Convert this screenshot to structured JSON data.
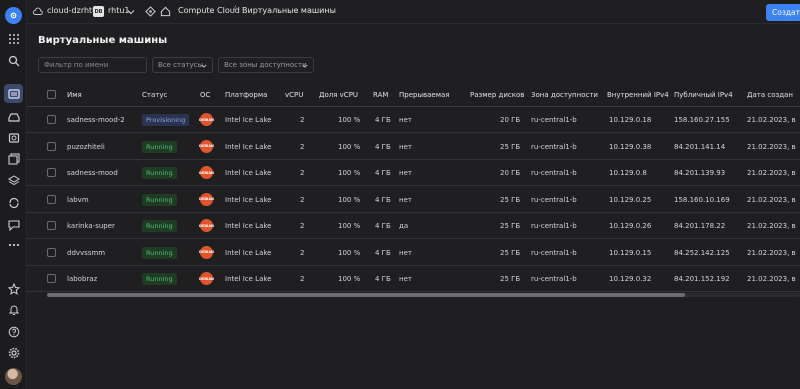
{
  "topbar": {
    "cloud": "cloud-dzrhtu",
    "folder_badge": "DB",
    "folder": "rhtu1",
    "service": "Compute Cloud",
    "separator": "/",
    "page": "Виртуальные машины",
    "create_label": "Создать"
  },
  "page": {
    "title": "Виртуальные машины",
    "search_placeholder": "Фильтр по имени",
    "status_filter": "Все статусы",
    "zone_filter": "Все зоны доступности"
  },
  "table": {
    "headers": [
      "Имя",
      "Статус",
      "ОС",
      "Платформа",
      "vCPU",
      "Доля vCPU",
      "RAM",
      "Прерываемая",
      "Размер дисков",
      "Зона доступности",
      "Внутренний IPv4",
      "Публичный IPv4",
      "Дата создан"
    ],
    "rows": [
      {
        "name": "sadness-mood-2",
        "status": "Provisioning",
        "os": "DEBIAN",
        "platform": "Intel Ice Lake",
        "vcpu": "2",
        "share": "100 %",
        "ram": "4 ГБ",
        "preempt": "нет",
        "disk": "20 ГБ",
        "zone": "ru-central1-b",
        "ip_in": "10.129.0.18",
        "ip_pub": "158.160.27.155",
        "date": "21.02.2023, в"
      },
      {
        "name": "puzozhiteli",
        "status": "Running",
        "os": "DEBIAN",
        "platform": "Intel Ice Lake",
        "vcpu": "2",
        "share": "100 %",
        "ram": "4 ГБ",
        "preempt": "нет",
        "disk": "25 ГБ",
        "zone": "ru-central1-b",
        "ip_in": "10.129.0.38",
        "ip_pub": "84.201.141.14",
        "date": "21.02.2023, в"
      },
      {
        "name": "sadness-mood",
        "status": "Running",
        "os": "DEBIAN",
        "platform": "Intel Ice Lake",
        "vcpu": "2",
        "share": "100 %",
        "ram": "4 ГБ",
        "preempt": "нет",
        "disk": "20 ГБ",
        "zone": "ru-central1-b",
        "ip_in": "10.129.0.8",
        "ip_pub": "84.201.139.93",
        "date": "21.02.2023, в"
      },
      {
        "name": "labvm",
        "status": "Running",
        "os": "DEBIAN",
        "platform": "Intel Ice Lake",
        "vcpu": "2",
        "share": "100 %",
        "ram": "4 ГБ",
        "preempt": "нет",
        "disk": "25 ГБ",
        "zone": "ru-central1-b",
        "ip_in": "10.129.0.25",
        "ip_pub": "158.160.10.169",
        "date": "21.02.2023, в"
      },
      {
        "name": "karinka-super",
        "status": "Running",
        "os": "DEBIAN",
        "platform": "Intel Ice Lake",
        "vcpu": "2",
        "share": "100 %",
        "ram": "4 ГБ",
        "preempt": "да",
        "disk": "25 ГБ",
        "zone": "ru-central1-b",
        "ip_in": "10.129.0.26",
        "ip_pub": "84.201.178.22",
        "date": "21.02.2023, в"
      },
      {
        "name": "ddvvssmm",
        "status": "Running",
        "os": "DEBIAN",
        "platform": "Intel Ice Lake",
        "vcpu": "2",
        "share": "100 %",
        "ram": "4 ГБ",
        "preempt": "нет",
        "disk": "25 ГБ",
        "zone": "ru-central1-b",
        "ip_in": "10.129.0.15",
        "ip_pub": "84.252.142.125",
        "date": "21.02.2023, в"
      },
      {
        "name": "labobraz",
        "status": "Running",
        "os": "DEBIAN",
        "platform": "Intel Ice Lake",
        "vcpu": "2",
        "share": "100 %",
        "ram": "4 ГБ",
        "preempt": "нет",
        "disk": "25 ГБ",
        "zone": "ru-central1-b",
        "ip_in": "10.129.0.32",
        "ip_pub": "84.201.152.192",
        "date": "21.02.2023, в"
      }
    ]
  },
  "colors": {
    "accent": "#3b82f6",
    "running": "#4fc16a",
    "provisioning": "#8aa4e8",
    "os_icon": "#e2552a"
  },
  "icons": [
    "logo-icon",
    "grid-icon",
    "search-icon",
    "vm-icon",
    "disk-icon",
    "snapshot-icon",
    "image-icon",
    "layers-icon",
    "sync-icon",
    "chat-icon",
    "more-icon",
    "star-icon",
    "bell-icon",
    "help-icon",
    "gear-icon"
  ]
}
